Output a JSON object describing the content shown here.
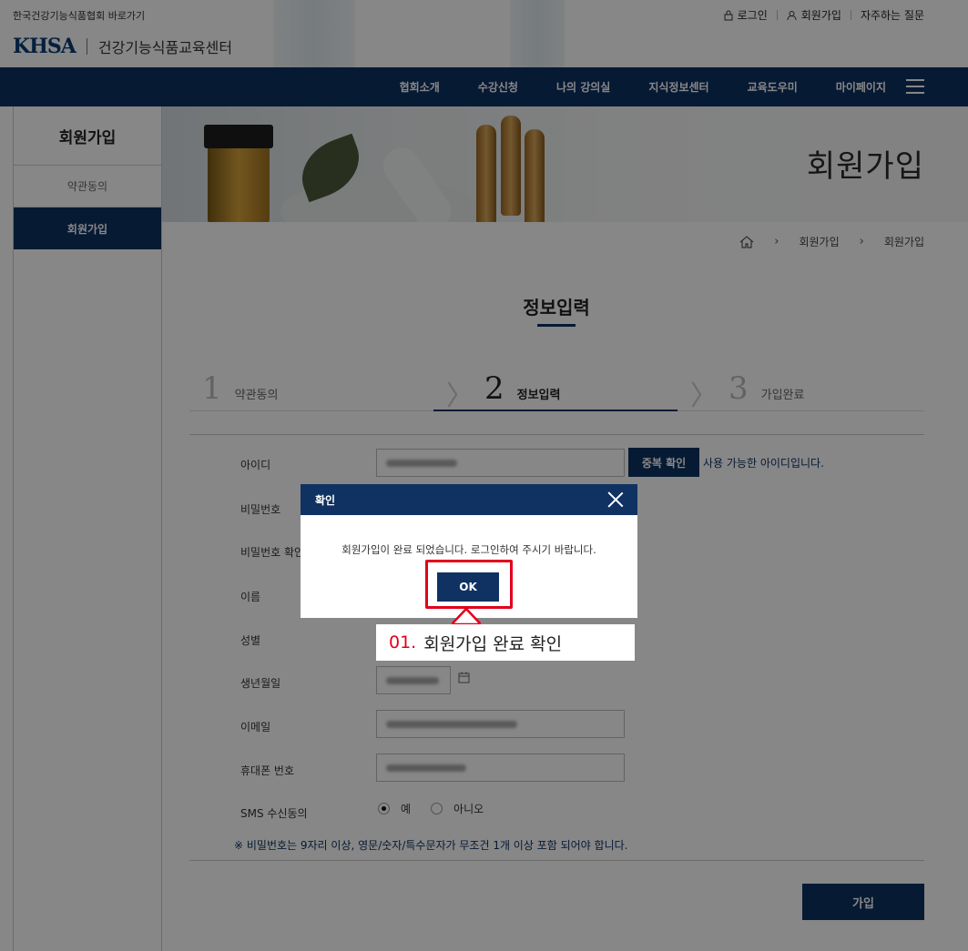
{
  "header": {
    "portal_link": "한국건강기능식품협회 바로가기",
    "logo_text": "KHSA",
    "center_name": "건강기능식품교육센터",
    "util_links": [
      "로그인",
      "회원가입",
      "자주하는 질문"
    ]
  },
  "nav": {
    "items": [
      "협회소개",
      "수강신청",
      "나의 강의실",
      "지식정보센터",
      "교육도우미",
      "마이페이지"
    ]
  },
  "sidebar": {
    "title": "회원가입",
    "items": [
      {
        "label": "약관동의",
        "active": false
      },
      {
        "label": "회원가입",
        "active": true
      }
    ]
  },
  "hero": {
    "title": "회원가입"
  },
  "breadcrumb": [
    "회원가입",
    "회원가입"
  ],
  "section": {
    "title": "정보입력"
  },
  "steps": [
    {
      "num": "1",
      "label": "약관동의",
      "active": false
    },
    {
      "num": "2",
      "label": "정보입력",
      "active": true
    },
    {
      "num": "3",
      "label": "가입완료",
      "active": false
    }
  ],
  "form": {
    "labels": [
      "아이디",
      "비밀번호",
      "비밀번호 확인",
      "이름",
      "성별",
      "생년월일",
      "이메일",
      "휴대폰 번호",
      "SMS 수신동의"
    ],
    "dup_check_label": "중복 확인",
    "available_message": "사용 가능한 아이디입니다.",
    "sms_options": [
      "예",
      "아니오"
    ],
    "sms_selected": "예",
    "notice": "※ 비밀번호는 9자리 이상, 영문/숫자/특수문자가 무조건 1개 이상 포함 되어야 합니다.",
    "submit_label": "가입"
  },
  "modal": {
    "title": "확인",
    "message": "회원가입이 완료 되었습니다. 로그인하여 주시기 바랍니다.",
    "ok_label": "OK"
  },
  "callout": {
    "number": "01.",
    "text": "회원가입 완료 확인"
  },
  "colors": {
    "primary_navy": "#0f3263",
    "highlight_red": "#e1001a"
  }
}
